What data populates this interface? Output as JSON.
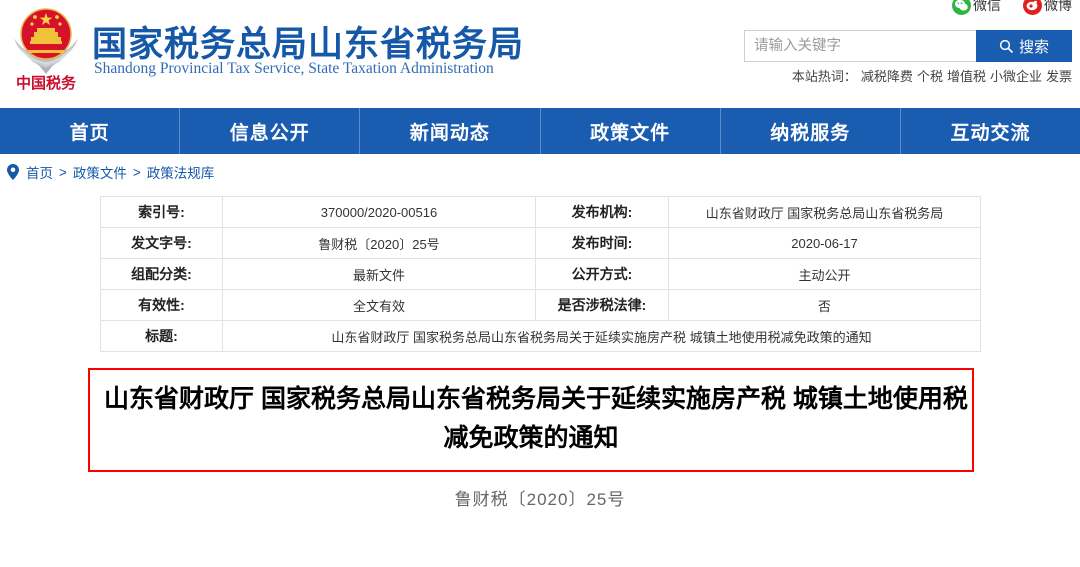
{
  "header": {
    "emblem_label": "中国税务",
    "site_title": "国家税务总局山东省税务局",
    "site_subtitle": "Shandong Provincial Tax Service, State Taxation Administration",
    "social": [
      {
        "label": "微信",
        "icon": "wechat-icon",
        "color": "#2db643"
      },
      {
        "label": "微博",
        "icon": "weibo-icon",
        "color": "#e02020"
      }
    ],
    "search": {
      "placeholder": "请输入关键字",
      "value": "",
      "button_label": "搜索",
      "icon": "search-icon"
    },
    "hotwords": {
      "label": "本站热词：",
      "items": [
        "减税降费",
        "个税",
        "增值税",
        "小微企业",
        "发票"
      ]
    }
  },
  "nav": {
    "items": [
      {
        "label": "首页"
      },
      {
        "label": "信息公开"
      },
      {
        "label": "新闻动态"
      },
      {
        "label": "政策文件"
      },
      {
        "label": "纳税服务"
      },
      {
        "label": "互动交流"
      }
    ]
  },
  "breadcrumb": {
    "icon": "location-pin-icon",
    "items": [
      "首页",
      "政策文件",
      "政策法规库"
    ],
    "separator": ">"
  },
  "doc_info": {
    "rows": [
      {
        "label_left": "索引号:",
        "value_left": "370000/2020-00516",
        "label_right": "发布机构:",
        "value_right": "山东省财政厅 国家税务总局山东省税务局"
      },
      {
        "label_left": "发文字号:",
        "value_left": "鲁财税〔2020〕25号",
        "label_right": "发布时间:",
        "value_right": "2020-06-17"
      },
      {
        "label_left": "组配分类:",
        "value_left": "最新文件",
        "label_right": "公开方式:",
        "value_right": "主动公开"
      },
      {
        "label_left": "有效性:",
        "value_left": "全文有效",
        "label_right": "是否涉税法律:",
        "value_right": "否"
      }
    ],
    "title_row": {
      "label": "标题:",
      "value": "山东省财政厅 国家税务总局山东省税务局关于延续实施房产税 城镇土地使用税减免政策的通知"
    }
  },
  "document": {
    "title_line1": "山东省财政厅 国家税务总局山东省税务局关于延续实施房产税 城镇土地使用税",
    "title_line2": "减免政策的通知",
    "doc_number": "鲁财税〔2020〕25号",
    "title_border_color": "#ff0000"
  },
  "colors": {
    "brand_blue": "#1a5cb0",
    "title_blue": "#1558a8",
    "red": "#ff0000"
  }
}
